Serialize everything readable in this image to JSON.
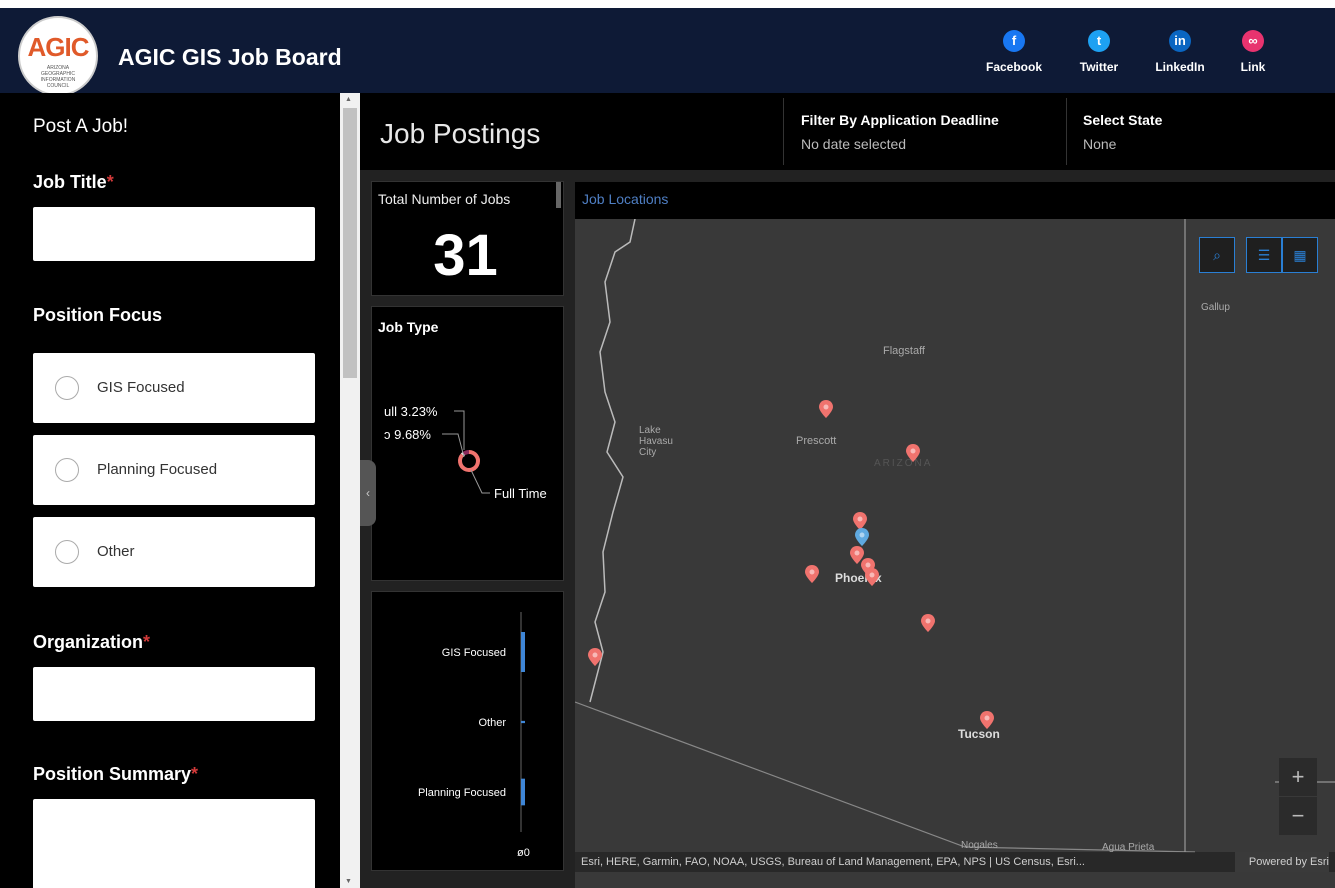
{
  "header": {
    "logo_text": "AGIC",
    "logo_subtext": "ARIZONA GEOGRAPHIC INFORMATION COUNCIL",
    "title": "AGIC GIS Job Board",
    "social": [
      {
        "label": "Facebook",
        "icon": "facebook-icon",
        "glyph": "f",
        "color": "#1877f2"
      },
      {
        "label": "Twitter",
        "icon": "twitter-icon",
        "glyph": "t",
        "color": "#1da1f2"
      },
      {
        "label": "LinkedIn",
        "icon": "linkedin-icon",
        "glyph": "in",
        "color": "#0a66c2"
      },
      {
        "label": "Link",
        "icon": "link-icon",
        "glyph": "∞",
        "color": "#e8336f"
      }
    ]
  },
  "form": {
    "heading": "Post A Job!",
    "required_mark": "*",
    "job_title_label": "Job Title",
    "job_title_value": "",
    "position_focus_label": "Position Focus",
    "focus_options": [
      "GIS Focused",
      "Planning Focused",
      "Other"
    ],
    "organization_label": "Organization",
    "organization_value": "",
    "summary_label": "Position Summary",
    "summary_value": ""
  },
  "topbar": {
    "title": "Job Postings",
    "filter_deadline_label": "Filter By Application Deadline",
    "filter_deadline_value": "No date selected",
    "state_label": "Select State",
    "state_value": "None"
  },
  "total_jobs": {
    "label": "Total Number of Jobs",
    "value": "31"
  },
  "job_type": {
    "title": "Job Type",
    "labels": [
      "ull 3.23%",
      "ɔ 9.68%",
      "Full Time"
    ],
    "chart_data": {
      "type": "pie",
      "slices": [
        {
          "label": "Full Time",
          "value": 87.09
        },
        {
          "label": "ull",
          "value": 3.23
        },
        {
          "label": "ɔ",
          "value": 9.68
        }
      ]
    }
  },
  "focus_chart": {
    "chart_data": {
      "type": "bar",
      "categories": [
        "GIS Focused",
        "Other",
        "Planning Focused"
      ],
      "values": [
        18,
        1,
        12
      ],
      "axis_label": "ø0"
    }
  },
  "map": {
    "title": "Job Locations",
    "cities": [
      "Flagstaff",
      "Prescott",
      "Lake Havasu City",
      "Phoenix",
      "Tucson",
      "Gallup",
      "ARIZONA",
      "Nogales",
      "Agua Prieta"
    ],
    "zoom_in": "+",
    "zoom_out": "−",
    "attribution": "Esri, HERE, Garmin, FAO, NOAA, USGS, Bureau of Land Management, EPA, NPS | US Census, Esri...",
    "powered_by": "Powered by Esri",
    "pin_color": "#f0736e",
    "selected_pin_color": "#5fa9e0"
  }
}
